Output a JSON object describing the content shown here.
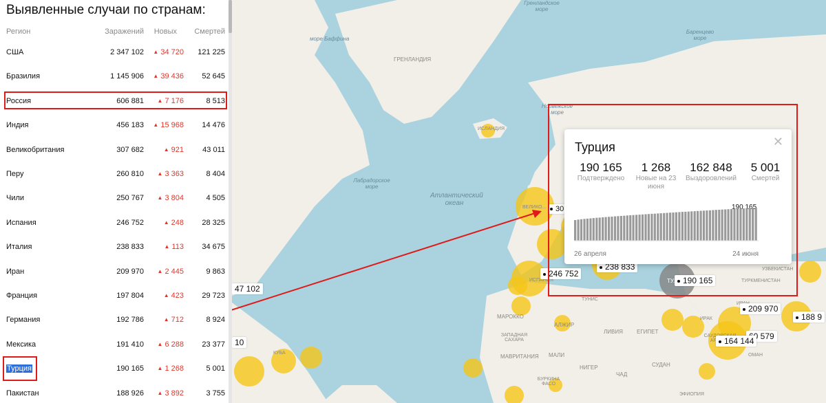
{
  "panel": {
    "title": "Выявленные случаи по странам:",
    "headers": {
      "region": "Регион",
      "cases": "Заражений",
      "new": "Новых",
      "deaths": "Смертей"
    },
    "rows": [
      {
        "name": "США",
        "cases": "2 347 102",
        "new": "34 720",
        "deaths": "121 225"
      },
      {
        "name": "Бразилия",
        "cases": "1 145 906",
        "new": "39 436",
        "deaths": "52 645"
      },
      {
        "name": "Россия",
        "cases": "606 881",
        "new": "7 176",
        "deaths": "8 513"
      },
      {
        "name": "Индия",
        "cases": "456 183",
        "new": "15 968",
        "deaths": "14 476"
      },
      {
        "name": "Великобритания",
        "cases": "307 682",
        "new": "921",
        "deaths": "43 011"
      },
      {
        "name": "Перу",
        "cases": "260 810",
        "new": "3 363",
        "deaths": "8 404"
      },
      {
        "name": "Чили",
        "cases": "250 767",
        "new": "3 804",
        "deaths": "4 505"
      },
      {
        "name": "Испания",
        "cases": "246 752",
        "new": "248",
        "deaths": "28 325"
      },
      {
        "name": "Италия",
        "cases": "238 833",
        "new": "113",
        "deaths": "34 675"
      },
      {
        "name": "Иран",
        "cases": "209 970",
        "new": "2 445",
        "deaths": "9 863"
      },
      {
        "name": "Франция",
        "cases": "197 804",
        "new": "423",
        "deaths": "29 723"
      },
      {
        "name": "Германия",
        "cases": "192 786",
        "new": "712",
        "deaths": "8 924"
      },
      {
        "name": "Мексика",
        "cases": "191 410",
        "new": "6 288",
        "deaths": "23 377"
      },
      {
        "name": "Турция",
        "cases": "190 165",
        "new": "1 268",
        "deaths": "5 001"
      },
      {
        "name": "Пакистан",
        "cases": "188 926",
        "new": "3 892",
        "deaths": "3 755"
      }
    ]
  },
  "map": {
    "water_labels": [
      {
        "text": "море Баффина"
      },
      {
        "text": "Лабрадорское море"
      },
      {
        "text": "Атлантический океан"
      },
      {
        "text": "Норвежское море"
      },
      {
        "text": "Баренцево море"
      },
      {
        "text": "Гренландское море"
      }
    ],
    "land_labels": [
      "ГРЕНЛАНДИЯ",
      "ИСЛАНДИЯ",
      "ВЕЛИКО...",
      "ИСПАНИЯ",
      "МАРОККО",
      "АЛЖИР",
      "ТУНИС",
      "ЕГИПЕТ",
      "ЗАПАДНАЯ САХАРА",
      "МАВРИТАНИЯ",
      "МАЛИ",
      "НИГЕР",
      "ЧАД",
      "СУДАН",
      "ЛИВИЯ",
      "ТУРКМЕНИСТАН",
      "УЗБЕКИСТАН",
      "ИРАН",
      "ИРАК",
      "САУДОВСКАЯ АРАВИЯ",
      "ОМАН",
      "БУРКИНА ФАСО",
      "ЭФИОПИЯ",
      "КУБА",
      "ТУ..."
    ],
    "bubble_labels": {
      "spain": "246 752",
      "italy": "238 833",
      "turkey": "190 165",
      "iran": "209 970",
      "uk": "30",
      "usa": "47 102",
      "mexico": "10",
      "saudi": "164 144",
      "egypt": "60 579",
      "pakistan": "188 9"
    }
  },
  "popup": {
    "country": "Турция",
    "stats": [
      {
        "value": "190 165",
        "label": "Подтверждено"
      },
      {
        "value": "1 268",
        "label": "Новые на 23 июня"
      },
      {
        "value": "162 848",
        "label": "Выздоровлений"
      },
      {
        "value": "5 001",
        "label": "Смертей"
      }
    ],
    "chart_start": "26 апреля",
    "chart_end": "24 июня",
    "chart_max_label": "190 165"
  },
  "colors": {
    "water": "#aad3df",
    "land": "#f2efe9",
    "bubble": "#f5c518",
    "bubble_selected": "#888888",
    "annotation": "#e01919",
    "new_cases": "#e2352a"
  }
}
